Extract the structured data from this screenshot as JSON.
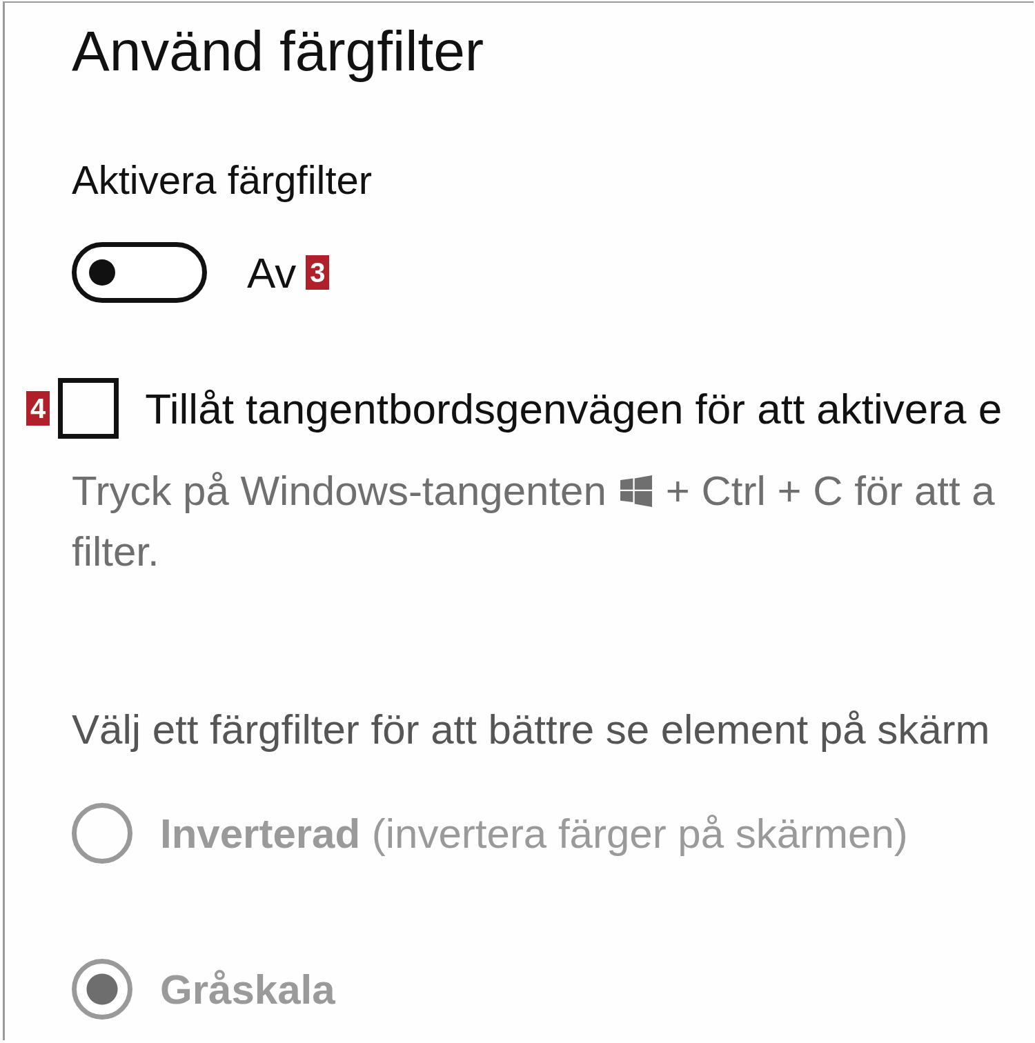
{
  "title": "Använd färgfilter",
  "toggle": {
    "label": "Aktivera färgfilter",
    "on": false,
    "state_text": "Av",
    "badge": "3"
  },
  "shortcut": {
    "badge": "4",
    "checked": false,
    "label": "Tillåt tangentbordsgenvägen för att aktivera e",
    "hint_before": "Tryck på Windows-tangenten",
    "hint_after": "+ Ctrl + C för att a",
    "hint_continuation": "filter."
  },
  "filter_prompt": "Välj ett färgfilter för att bättre se element på skärm",
  "filters": [
    {
      "name": "Inverterad",
      "note": "(invertera färger på skärmen)",
      "selected": false,
      "disabled": true
    },
    {
      "name": "Gråskala",
      "selected": true,
      "disabled": true
    }
  ]
}
